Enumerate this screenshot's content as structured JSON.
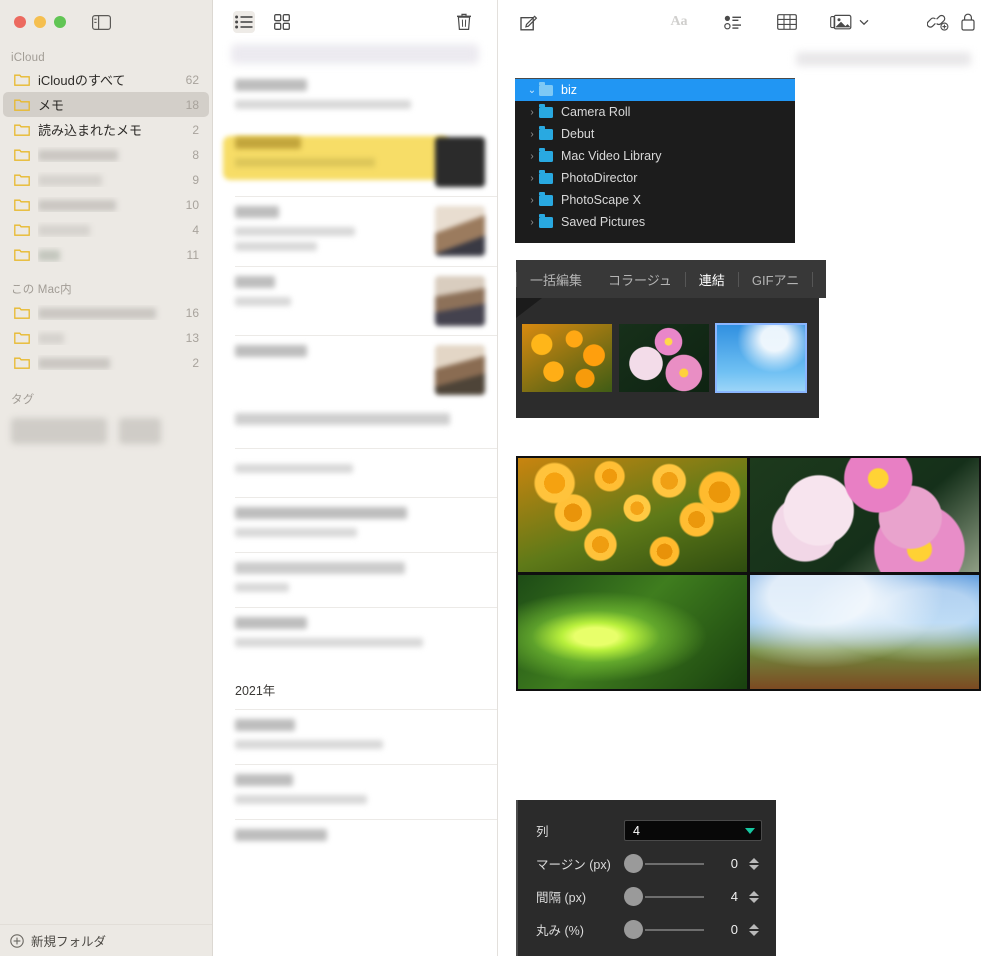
{
  "notes_app": {
    "sidebar": {
      "sections": [
        {
          "title": "iCloud",
          "redacted": false,
          "items": [
            {
              "label": "iCloudのすべて",
              "count": "62",
              "redacted": false,
              "selected": false,
              "redact_w": 0
            },
            {
              "label": "メモ",
              "count": "18",
              "redacted": false,
              "selected": true,
              "redact_w": 0
            },
            {
              "label": "読み込まれたメモ",
              "count": "2",
              "redacted": false,
              "selected": false,
              "redact_w": 0
            },
            {
              "label": "",
              "count": "8",
              "redacted": true,
              "selected": false,
              "redact_w": 80
            },
            {
              "label": "",
              "count": "9",
              "redacted": true,
              "selected": false,
              "redact_w": 64
            },
            {
              "label": "",
              "count": "10",
              "redacted": true,
              "selected": false,
              "redact_w": 78
            },
            {
              "label": "",
              "count": "4",
              "redacted": true,
              "selected": false,
              "redact_w": 52
            },
            {
              "label": "",
              "count": "11",
              "redacted": true,
              "selected": false,
              "redact_w": 22
            }
          ]
        },
        {
          "title": "この Mac内",
          "redacted": false,
          "items": [
            {
              "label": "",
              "count": "16",
              "redacted": true,
              "selected": false,
              "redact_w": 118
            },
            {
              "label": "",
              "count": "13",
              "redacted": true,
              "selected": false,
              "redact_w": 26
            },
            {
              "label": "",
              "count": "2",
              "redacted": true,
              "selected": false,
              "redact_w": 72
            }
          ]
        }
      ],
      "tags_section": "タグ",
      "tags": [
        {
          "w": 96
        },
        {
          "w": 42
        }
      ],
      "new_folder_label": "新規フォルダ",
      "toggle_sidebar_icon": "sidebar-toggle-icon"
    },
    "list_toolbar": {
      "list_view_icon": "list-view-icon",
      "gallery_view_icon": "gallery-view-icon",
      "delete_icon": "trash-icon"
    },
    "notes_list": {
      "year_header": "2021年",
      "items_top": [
        {
          "selected": false,
          "title_w": 72,
          "sub_w": 176,
          "sub2_w": 0,
          "thumb": "",
          "sep": false
        },
        {
          "selected": true,
          "title_w": 66,
          "sub_w": 140,
          "sub2_w": 0,
          "thumb": "dark",
          "sep": false
        },
        {
          "selected": false,
          "title_w": 44,
          "sub_w": 120,
          "sub2_w": 82,
          "thumb": "warm",
          "sep": true
        },
        {
          "selected": false,
          "title_w": 40,
          "sub_w": 56,
          "sub2_w": 0,
          "thumb": "warm2",
          "sep": true
        },
        {
          "selected": false,
          "title_w": 72,
          "sub_w": 0,
          "sub2_w": 0,
          "thumb": "warm3",
          "sep": true
        },
        {
          "selected": false,
          "title_w": 215,
          "sub_w": 0,
          "sub2_w": 0,
          "thumb": "",
          "sep": false
        },
        {
          "selected": false,
          "title_w": 118,
          "sub_w": 0,
          "sub2_w": 0,
          "thumb": "",
          "sep": true
        },
        {
          "selected": false,
          "title_w": 172,
          "sub_w": 122,
          "sub2_w": 0,
          "thumb": "",
          "sep": true
        },
        {
          "selected": false,
          "title_w": 170,
          "sub_w": 54,
          "sub2_w": 0,
          "thumb": "",
          "sep": true
        },
        {
          "selected": false,
          "title_w": 72,
          "sub_w": 188,
          "sub2_w": 0,
          "thumb": "",
          "sep": false
        }
      ],
      "items_bottom": [
        {
          "selected": false,
          "title_w": 60,
          "sub_w": 148,
          "sub2_w": 0,
          "thumb": "",
          "sep": true
        },
        {
          "selected": false,
          "title_w": 58,
          "sub_w": 132,
          "sub2_w": 0,
          "thumb": "",
          "sep": true
        },
        {
          "selected": false,
          "title_w": 92,
          "sub_w": 0,
          "sub2_w": 0,
          "thumb": "",
          "sep": false
        }
      ]
    },
    "detail_toolbar": {
      "compose_icon": "compose-note-icon",
      "format_icon": "format-text-aa-icon",
      "checklist_icon": "checklist-icon",
      "table_icon": "table-icon",
      "media_icon": "media-insert-icon",
      "media_chevron_icon": "chevron-down-icon",
      "link_icon": "add-link-icon",
      "lock_icon": "lock-note-icon"
    }
  },
  "photoscape": {
    "tree": {
      "items": [
        {
          "label": "biz",
          "selected": true,
          "expandable": true
        },
        {
          "label": "Camera Roll",
          "selected": false,
          "expandable": true
        },
        {
          "label": "Debut",
          "selected": false,
          "expandable": true
        },
        {
          "label": "Mac Video Library",
          "selected": false,
          "expandable": true
        },
        {
          "label": "PhotoDirector",
          "selected": false,
          "expandable": true
        },
        {
          "label": "PhotoScape X",
          "selected": false,
          "expandable": true
        },
        {
          "label": "Saved Pictures",
          "selected": false,
          "expandable": true
        }
      ]
    },
    "tabs": [
      {
        "label": "一括編集",
        "active": false
      },
      {
        "label": "コラージュ",
        "active": false
      },
      {
        "label": "連結",
        "active": true
      },
      {
        "label": "GIFアニ",
        "active": false
      }
    ],
    "filmstrip": [
      {
        "name": "orange-flowers-thumb",
        "selected": false
      },
      {
        "name": "pink-cosmos-thumb",
        "selected": false
      },
      {
        "name": "bird-in-sky-thumb",
        "selected": true
      }
    ],
    "collage_cells": [
      {
        "name": "orange-flowers-cell"
      },
      {
        "name": "pink-roses-cell"
      },
      {
        "name": "green-filament-plant-cell"
      },
      {
        "name": "red-leaves-sky-cell"
      }
    ],
    "controls": {
      "columns": {
        "label": "列",
        "value": "4"
      },
      "margin": {
        "label": "マージン (px)",
        "value": "0",
        "knob_pct": 8
      },
      "spacing": {
        "label": "間隔 (px)",
        "value": "4",
        "knob_pct": 2
      },
      "round": {
        "label": "丸み (%)",
        "value": "0",
        "knob_pct": 0
      }
    },
    "colors": {
      "selection_blue": "#2196f3",
      "accent_teal": "#15c7a0",
      "panel_bg": "#2b2b2b",
      "tree_bg": "#1c1c1c"
    }
  }
}
